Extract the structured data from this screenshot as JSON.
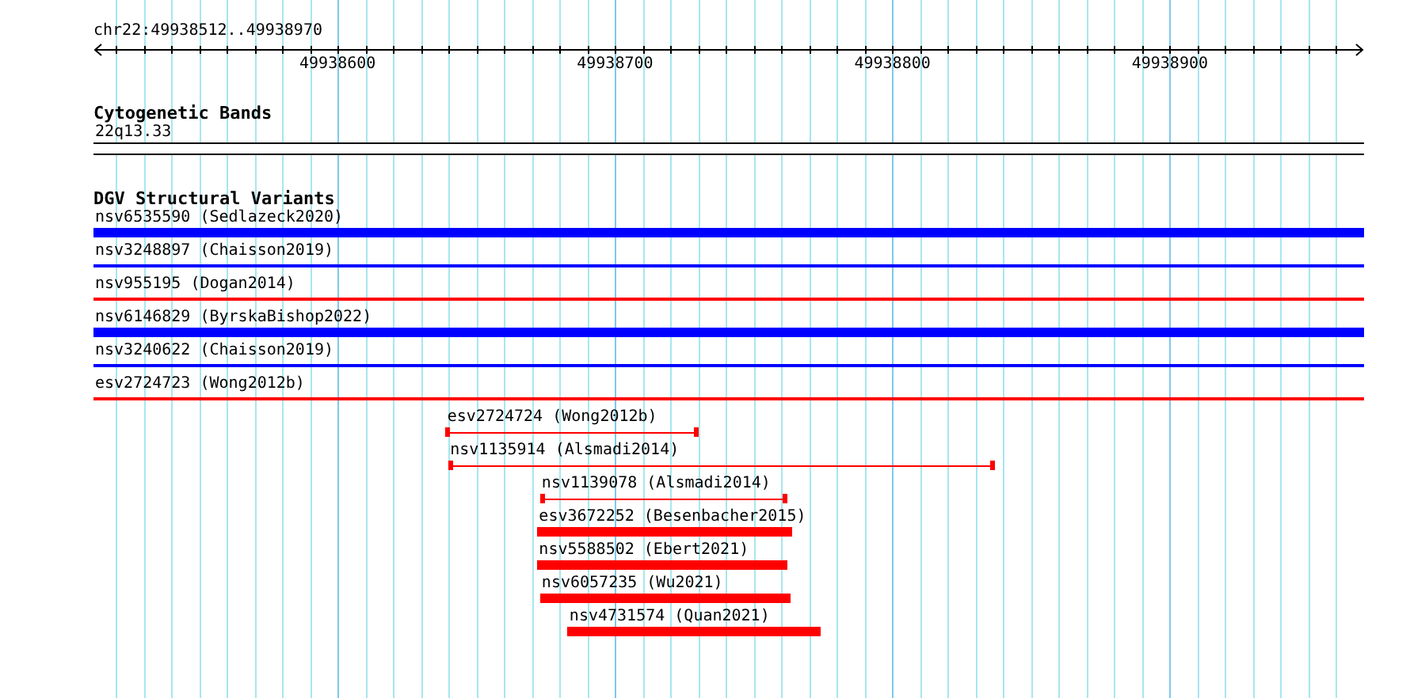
{
  "ruler": {
    "location": "chr22:49938512..49938970",
    "tick_labels": [
      "49938600",
      "49938700",
      "49938800",
      "49938900"
    ]
  },
  "tracks": [
    {
      "title": "Cytogenetic Bands",
      "features": [
        {
          "label": "22q13.33",
          "kind": "band",
          "color": "#000000"
        }
      ]
    },
    {
      "title": "DGV Structural Variants",
      "features": [
        {
          "label": "nsv6535590 (Sedlazeck2020)",
          "kind": "thick",
          "color": "#0000ff"
        },
        {
          "label": "nsv3248897 (Chaisson2019)",
          "kind": "line",
          "color": "#0000ff"
        },
        {
          "label": "nsv955195 (Dogan2014)",
          "kind": "line",
          "color": "#ff0000"
        },
        {
          "label": "nsv6146829 (ByrskaBishop2022)",
          "kind": "thick",
          "color": "#0000ff"
        },
        {
          "label": "nsv3240622 (Chaisson2019)",
          "kind": "line",
          "color": "#0000ff"
        },
        {
          "label": "esv2724723 (Wong2012b)",
          "kind": "line",
          "color": "#ff0000"
        },
        {
          "label": "esv2724724 (Wong2012b)",
          "kind": "capped",
          "color": "#ff0000"
        },
        {
          "label": "nsv1135914 (Alsmadi2014)",
          "kind": "capped",
          "color": "#ff0000"
        },
        {
          "label": "nsv1139078 (Alsmadi2014)",
          "kind": "capped",
          "color": "#ff0000"
        },
        {
          "label": "esv3672252 (Besenbacher2015)",
          "kind": "thick",
          "color": "#ff0000"
        },
        {
          "label": "nsv5588502 (Ebert2021)",
          "kind": "thick",
          "color": "#ff0000"
        },
        {
          "label": "nsv6057235 (Wu2021)",
          "kind": "thick",
          "color": "#ff0000"
        },
        {
          "label": "nsv4731574 (Quan2021)",
          "kind": "thick",
          "color": "#ff0000"
        }
      ]
    }
  ]
}
